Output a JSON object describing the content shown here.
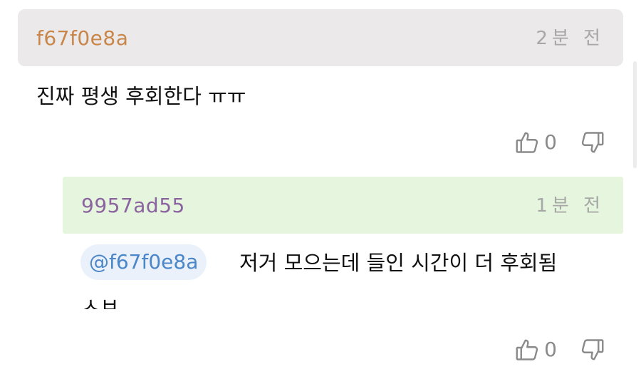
{
  "comments": [
    {
      "author": "f67f0e8a",
      "time": "2분 전",
      "body": "진짜 평생 후회한다 ㅠㅠ",
      "likes": "0"
    },
    {
      "author": "9957ad55",
      "time": "1분 전",
      "mention": "@f67f0e8a",
      "body": "저거 모으는데 들인 시간이 더 후회됨",
      "body_cont": "ㅅㅂ",
      "likes": "0"
    }
  ],
  "icons": {
    "like": "thumbs-up-icon",
    "dislike": "thumbs-down-icon"
  },
  "colors": {
    "author1": "#c9864a",
    "author2": "#8b63a0",
    "header1_bg": "#ebe9ea",
    "header2_bg": "#e6f5dd",
    "mention": "#4a86c8",
    "mention_bg": "#eaf1fb",
    "muted": "#a7a7a7"
  }
}
